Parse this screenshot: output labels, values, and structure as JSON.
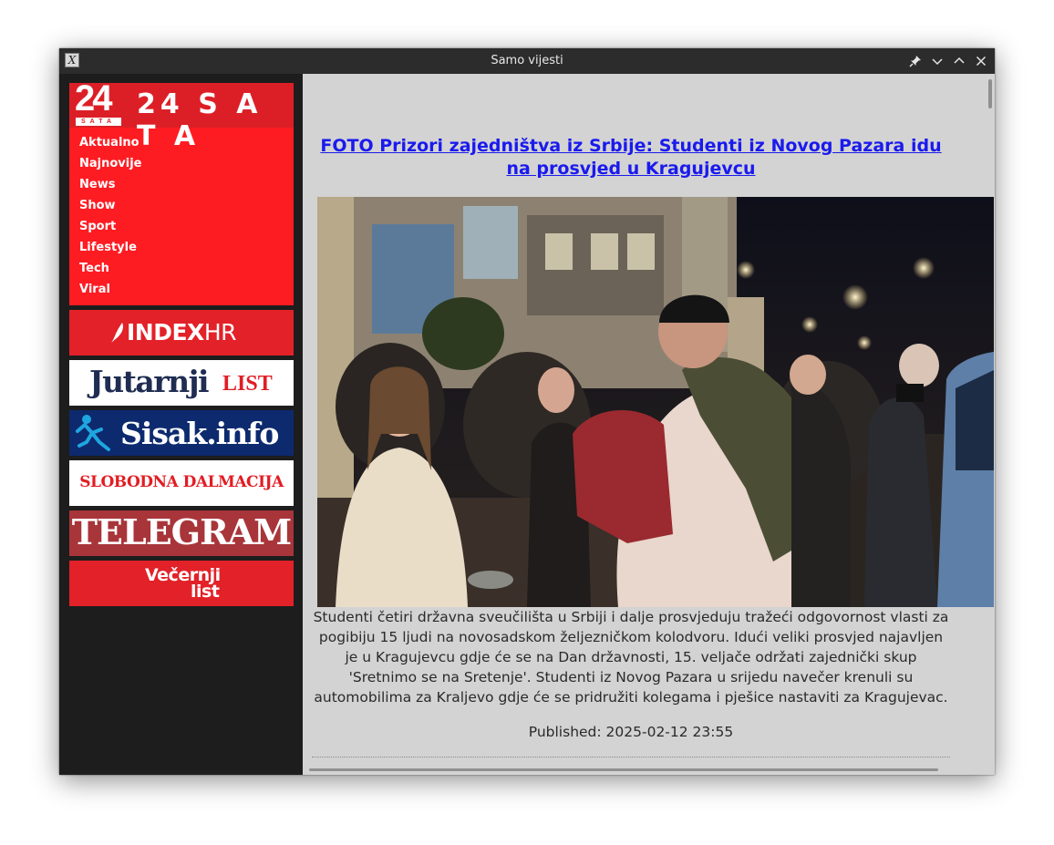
{
  "window": {
    "title": "Samo vijesti"
  },
  "titlebar": {
    "app_icon_glyph": "X",
    "buttons": [
      "pin-icon",
      "minimize-icon",
      "maximize-icon",
      "close-icon"
    ]
  },
  "sidebar": {
    "site_24sata": {
      "logo_number": "24",
      "logo_small": "SATA",
      "logo_wordmark": "24 S A T A",
      "nav": [
        "Aktualno",
        "Najnovije",
        "News",
        "Show",
        "Sport",
        "Lifestyle",
        "Tech",
        "Viral"
      ]
    },
    "banners": {
      "index": {
        "main": "INDEX",
        "suffix": "HR"
      },
      "jutarnji": {
        "main": "Jutarnji",
        "suffix": "LIST"
      },
      "sisak": {
        "main": "Sisak.info"
      },
      "slobodna": {
        "main": "SLOBODNA DALMACIJA"
      },
      "telegram": {
        "main": "TELEGRAM"
      },
      "vecernji": {
        "line1": "Večernji",
        "line2": "list"
      }
    }
  },
  "article": {
    "title": "FOTO Prizori zajedništva iz Srbije: Studenti iz Novog Pazara idu na prosvjed u Kragujevcu",
    "description": "Studenti četiri državna sveučilišta u Srbiji i dalje prosvjeduju tražeći odgovornost vlasti za pogibiju 15 ljudi na novosadskom željezničkom kolodvoru. Idući veliki prosvjed najavljen je u Kragujevcu gdje će se na Dan državnosti, 15. veljače održati zajednički skup 'Sretnimo se na Sretenje'. Studenti iz Novog Pazara u srijedu navečer krenuli su automobilima za Kraljevo gdje će se pridružiti kolegama i pješice nastaviti za Kragujevac.",
    "published": "Published: 2025-02-12 23:55"
  },
  "colors": {
    "brand_24sata": "#fe1c23",
    "link": "#1a1aee",
    "content_bg": "#d3d3d3",
    "sidebar_bg": "#1d1d1d"
  }
}
